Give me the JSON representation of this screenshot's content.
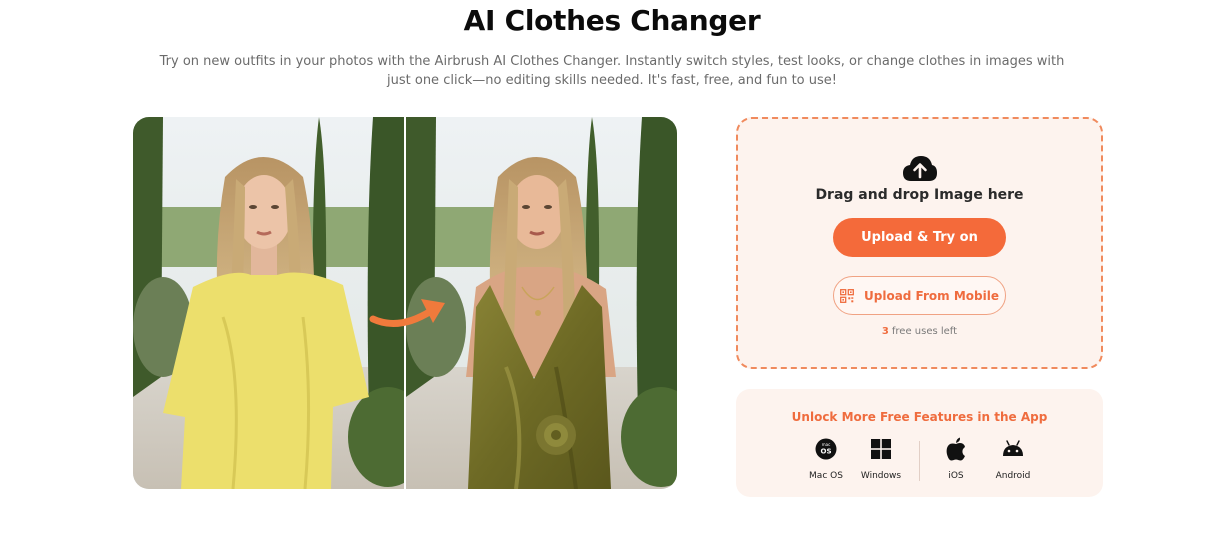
{
  "header": {
    "title": "AI Clothes Changer",
    "subtitle": "Try on new outfits in your photos with the Airbrush AI Clothes Changer. Instantly switch styles, test looks, or change clothes in images with just one click—no editing skills needed. It's fast, free, and fun to use!"
  },
  "showcase": {
    "before_image": "woman-yellow-tshirt-photo",
    "after_image": "woman-olive-satin-dress-photo",
    "arrow_icon": "curved-arrow-icon"
  },
  "upload": {
    "icon": "cloud-upload-icon",
    "drop_text": "Drag and drop Image here",
    "primary_button": "Upload & Try on",
    "mobile_button": "Upload From Mobile",
    "mobile_icon": "qr-code-icon",
    "free_uses_count": "3",
    "free_uses_text": "free uses left"
  },
  "app": {
    "title": "Unlock More Free Features in the App",
    "platforms": [
      {
        "label": "Mac OS",
        "icon": "macos-icon"
      },
      {
        "label": "Windows",
        "icon": "windows-icon"
      },
      {
        "label": "iOS",
        "icon": "apple-icon"
      },
      {
        "label": "Android",
        "icon": "android-icon"
      }
    ]
  },
  "colors": {
    "accent": "#f46a3a",
    "card_bg": "#fdf3ee",
    "dashed_border": "#f08a5d"
  }
}
